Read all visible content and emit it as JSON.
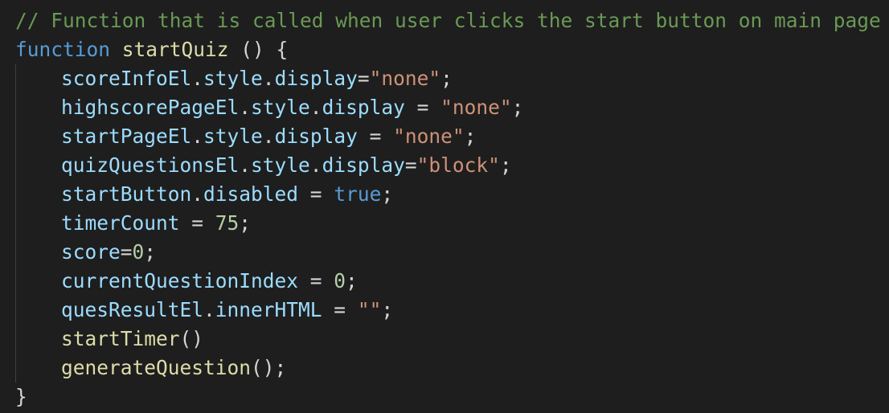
{
  "code": {
    "lines": [
      {
        "indent": 0,
        "tokens": [
          {
            "t": "// Function that is called when user clicks the start button on main page",
            "c": "comment"
          }
        ]
      },
      {
        "indent": 0,
        "tokens": [
          {
            "t": "function",
            "c": "keyword"
          },
          {
            "t": " ",
            "c": "punct"
          },
          {
            "t": "startQuiz",
            "c": "func"
          },
          {
            "t": " () {",
            "c": "punct"
          }
        ]
      },
      {
        "indent": 1,
        "tokens": [
          {
            "t": "scoreInfoEl",
            "c": "var"
          },
          {
            "t": ".",
            "c": "punct"
          },
          {
            "t": "style",
            "c": "var"
          },
          {
            "t": ".",
            "c": "punct"
          },
          {
            "t": "display",
            "c": "var"
          },
          {
            "t": "=",
            "c": "punct"
          },
          {
            "t": "\"none\"",
            "c": "string"
          },
          {
            "t": ";",
            "c": "punct"
          }
        ]
      },
      {
        "indent": 1,
        "tokens": [
          {
            "t": "highscorePageEl",
            "c": "var"
          },
          {
            "t": ".",
            "c": "punct"
          },
          {
            "t": "style",
            "c": "var"
          },
          {
            "t": ".",
            "c": "punct"
          },
          {
            "t": "display",
            "c": "var"
          },
          {
            "t": " = ",
            "c": "punct"
          },
          {
            "t": "\"none\"",
            "c": "string"
          },
          {
            "t": ";",
            "c": "punct"
          }
        ]
      },
      {
        "indent": 1,
        "tokens": [
          {
            "t": "startPageEl",
            "c": "var"
          },
          {
            "t": ".",
            "c": "punct"
          },
          {
            "t": "style",
            "c": "var"
          },
          {
            "t": ".",
            "c": "punct"
          },
          {
            "t": "display",
            "c": "var"
          },
          {
            "t": " = ",
            "c": "punct"
          },
          {
            "t": "\"none\"",
            "c": "string"
          },
          {
            "t": ";",
            "c": "punct"
          }
        ]
      },
      {
        "indent": 1,
        "tokens": [
          {
            "t": "quizQuestionsEl",
            "c": "var"
          },
          {
            "t": ".",
            "c": "punct"
          },
          {
            "t": "style",
            "c": "var"
          },
          {
            "t": ".",
            "c": "punct"
          },
          {
            "t": "display",
            "c": "var"
          },
          {
            "t": "=",
            "c": "punct"
          },
          {
            "t": "\"block\"",
            "c": "string"
          },
          {
            "t": ";",
            "c": "punct"
          }
        ]
      },
      {
        "indent": 1,
        "tokens": [
          {
            "t": "startButton",
            "c": "var"
          },
          {
            "t": ".",
            "c": "punct"
          },
          {
            "t": "disabled",
            "c": "var"
          },
          {
            "t": " = ",
            "c": "punct"
          },
          {
            "t": "true",
            "c": "const"
          },
          {
            "t": ";",
            "c": "punct"
          }
        ]
      },
      {
        "indent": 1,
        "tokens": [
          {
            "t": "timerCount",
            "c": "var"
          },
          {
            "t": " = ",
            "c": "punct"
          },
          {
            "t": "75",
            "c": "number"
          },
          {
            "t": ";",
            "c": "punct"
          }
        ]
      },
      {
        "indent": 1,
        "tokens": [
          {
            "t": "score",
            "c": "var"
          },
          {
            "t": "=",
            "c": "punct"
          },
          {
            "t": "0",
            "c": "number"
          },
          {
            "t": ";",
            "c": "punct"
          }
        ]
      },
      {
        "indent": 1,
        "tokens": [
          {
            "t": "currentQuestionIndex",
            "c": "var"
          },
          {
            "t": " = ",
            "c": "punct"
          },
          {
            "t": "0",
            "c": "number"
          },
          {
            "t": ";",
            "c": "punct"
          }
        ]
      },
      {
        "indent": 1,
        "tokens": [
          {
            "t": "quesResultEl",
            "c": "var"
          },
          {
            "t": ".",
            "c": "punct"
          },
          {
            "t": "innerHTML",
            "c": "var"
          },
          {
            "t": " = ",
            "c": "punct"
          },
          {
            "t": "\"\"",
            "c": "string"
          },
          {
            "t": ";",
            "c": "punct"
          }
        ]
      },
      {
        "indent": 1,
        "tokens": [
          {
            "t": "startTimer",
            "c": "func"
          },
          {
            "t": "()",
            "c": "punct"
          }
        ]
      },
      {
        "indent": 1,
        "tokens": [
          {
            "t": "generateQuestion",
            "c": "func"
          },
          {
            "t": "();",
            "c": "punct"
          }
        ]
      },
      {
        "indent": 0,
        "tokens": [
          {
            "t": "}",
            "c": "punct"
          }
        ]
      }
    ]
  },
  "theme": {
    "background": "#1e1e1e",
    "comment": "#6a9955",
    "keyword": "#569cd6",
    "function": "#dcdcaa",
    "variable": "#9cdcfe",
    "string": "#ce9178",
    "number": "#b5cea8",
    "punctuation": "#d4d4d4"
  }
}
